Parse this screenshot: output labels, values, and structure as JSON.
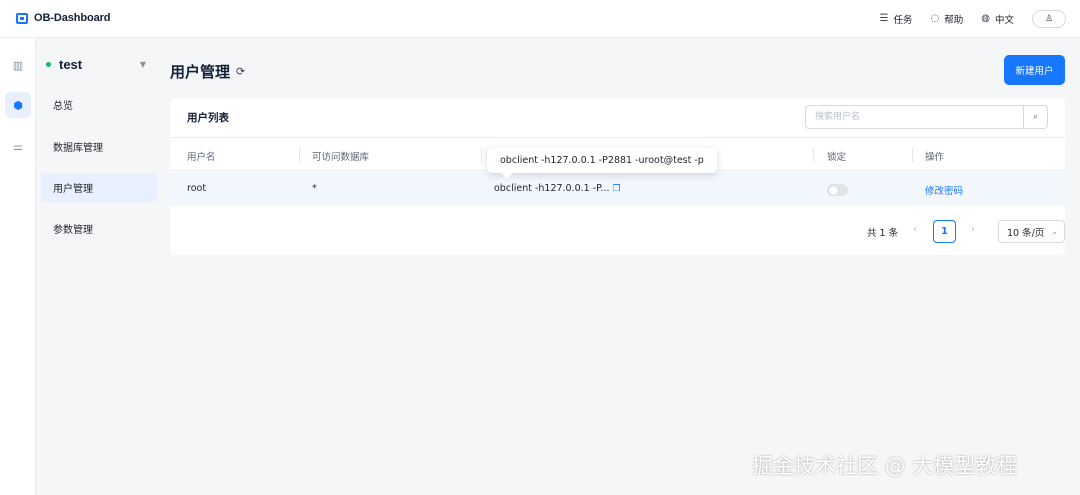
{
  "app": {
    "title": "OB-Dashboard"
  },
  "header": {
    "actions": [
      {
        "icon": "list-icon",
        "glyph": "☰",
        "label": "任务"
      },
      {
        "icon": "bulb-icon",
        "glyph": "◌",
        "label": "帮助"
      },
      {
        "icon": "globe-icon",
        "glyph": "◍",
        "label": "中文"
      }
    ],
    "user_glyph": "♙"
  },
  "rail": {
    "items": [
      {
        "icon": "bar-chart-icon",
        "glyph": "▥",
        "active": false
      },
      {
        "icon": "cube-icon",
        "glyph": "⬢",
        "active": true
      },
      {
        "icon": "sliders-icon",
        "glyph": "⚌",
        "active": false
      }
    ]
  },
  "tenant": {
    "name": "test",
    "status_color": "#10b981",
    "caret": "▼"
  },
  "nav": {
    "items": [
      {
        "label": "总览"
      },
      {
        "label": "数据库管理"
      },
      {
        "label": "用户管理"
      },
      {
        "label": "参数管理"
      }
    ]
  },
  "page": {
    "title": "用户管理",
    "refresh_glyph": "⟳",
    "new_user_label": "新建用户"
  },
  "list": {
    "title": "用户列表",
    "search_placeholder": "搜索用户名",
    "search_glyph": "⌕",
    "columns": [
      "用户名",
      "可访问数据库",
      "",
      "锁定",
      "操作"
    ],
    "rows": [
      {
        "username": "root",
        "databases": "*",
        "connection": "obclient -h127.0.0.1 -P...",
        "locked": false,
        "action": "修改密码"
      }
    ],
    "tooltip": "obclient -h127.0.0.1 -P2881 -uroot@test -p"
  },
  "pagination": {
    "total": "共 1 条",
    "prev": "‹",
    "next": "›",
    "current_page": "1",
    "page_size": "10 条/页",
    "size_caret": "⌄"
  },
  "watermark": "掘金技术社区 @ 大模型教程",
  "colors": {
    "accent": "#1677ff",
    "online": "#10b981"
  }
}
